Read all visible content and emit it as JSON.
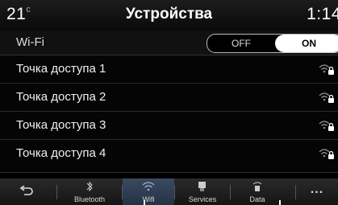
{
  "header": {
    "temperature": "21",
    "temperature_unit": "c",
    "title": "Устройства",
    "time": "1:14"
  },
  "wifi": {
    "label": "Wi-Fi",
    "off_label": "OFF",
    "on_label": "ON",
    "state": "ON"
  },
  "access_points": [
    {
      "name": "Точка доступа 1",
      "icon": "wifi-lock-icon"
    },
    {
      "name": "Точка доступа 2",
      "icon": "wifi-lock-icon"
    },
    {
      "name": "Точка доступа 3",
      "icon": "wifi-lock-icon"
    },
    {
      "name": "Точка доступа 4",
      "icon": "wifi-lock-icon"
    }
  ],
  "bottom_nav": {
    "back_icon": "back-icon",
    "items": [
      {
        "label": "Bluetooth",
        "icon": "bluetooth-icon",
        "active": false
      },
      {
        "label": "Wifi",
        "icon": "wifi-icon",
        "active": true
      },
      {
        "label": "Services",
        "icon": "services-icon",
        "active": false
      },
      {
        "label": "Data",
        "icon": "data-icon",
        "active": false
      }
    ],
    "more_label": "..."
  },
  "colors": {
    "background": "#000000",
    "active_tab": "#2e3e54",
    "toggle_on": "#ffffff"
  }
}
